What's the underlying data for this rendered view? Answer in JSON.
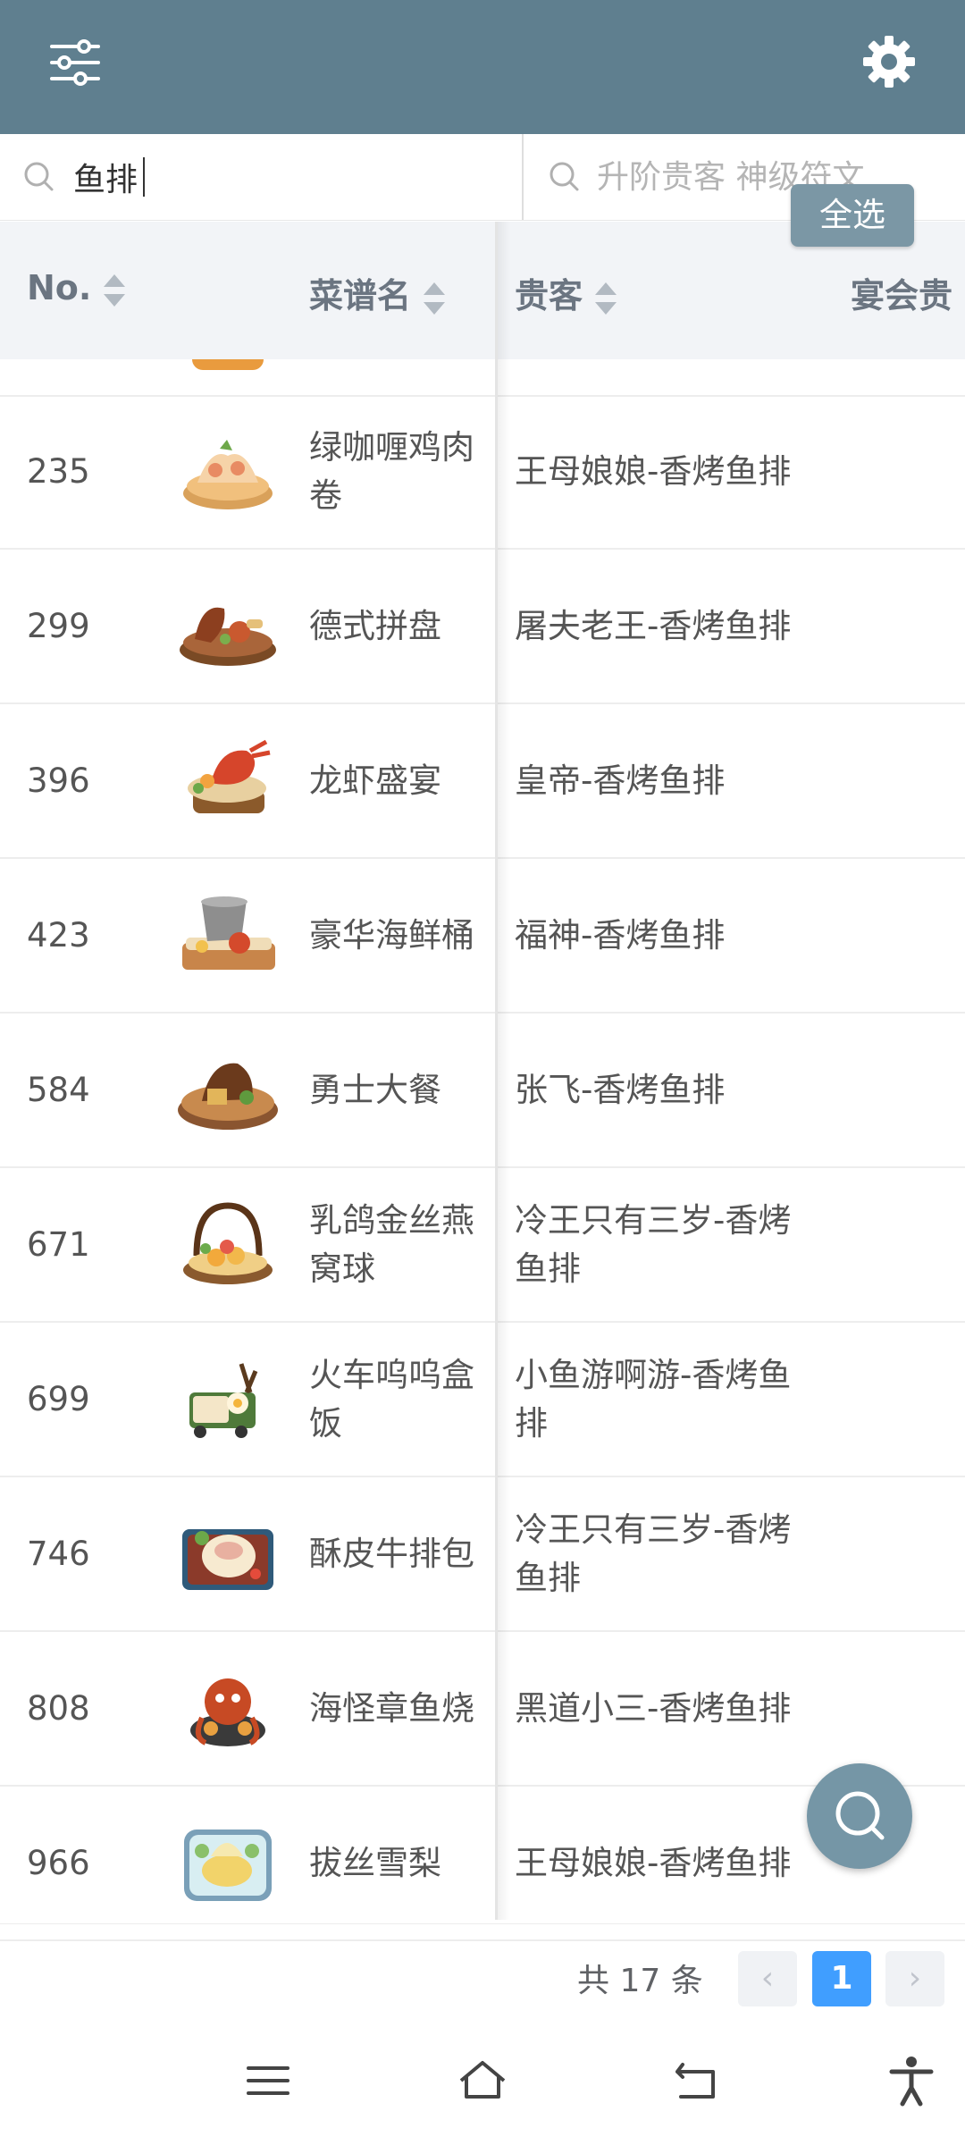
{
  "search": {
    "dish_value": "鱼排",
    "guest_placeholder": "升阶贵客 神级符文"
  },
  "select_all_label": "全选",
  "table": {
    "columns": [
      {
        "label": "No."
      },
      {
        "label": "菜谱名"
      },
      {
        "label": "贵客"
      },
      {
        "label": "宴会贵"
      }
    ],
    "rows": [
      {
        "no": "235",
        "name": "绿咖喱鸡肉卷",
        "guest": "王母娘娘-香烤鱼排",
        "dish_icon": "green-curry-chicken-roll-dish-icon"
      },
      {
        "no": "299",
        "name": "德式拼盘",
        "guest": "屠夫老王-香烤鱼排",
        "dish_icon": "german-platter-dish-icon"
      },
      {
        "no": "396",
        "name": "龙虾盛宴",
        "guest": "皇帝-香烤鱼排",
        "dish_icon": "lobster-feast-dish-icon"
      },
      {
        "no": "423",
        "name": "豪华海鲜桶",
        "guest": "福神-香烤鱼排",
        "dish_icon": "seafood-bucket-dish-icon"
      },
      {
        "no": "584",
        "name": "勇士大餐",
        "guest": "张飞-香烤鱼排",
        "dish_icon": "warrior-meal-dish-icon"
      },
      {
        "no": "671",
        "name": "乳鸽金丝燕窝球",
        "guest": "冷王只有三岁-香烤鱼排",
        "dish_icon": "pigeon-nest-ball-dish-icon"
      },
      {
        "no": "699",
        "name": "火车呜呜盒饭",
        "guest": "小鱼游啊游-香烤鱼排",
        "dish_icon": "train-bento-dish-icon"
      },
      {
        "no": "746",
        "name": "酥皮牛排包",
        "guest": "冷王只有三岁-香烤鱼排",
        "dish_icon": "steak-pastry-dish-icon"
      },
      {
        "no": "808",
        "name": "海怪章鱼烧",
        "guest": "黑道小三-香烤鱼排",
        "dish_icon": "octopus-ball-dish-icon"
      },
      {
        "no": "966",
        "name": "拔丝雪梨",
        "guest": "王母娘娘-香烤鱼排",
        "dish_icon": "candied-pear-dish-icon"
      }
    ]
  },
  "pagination": {
    "total_text": "共 17 条",
    "current_page": "1",
    "prev_symbol": "‹",
    "next_symbol": "›"
  },
  "colors": {
    "header_bg": "#5f7f8f",
    "accent": "#409eff",
    "fab_bg": "#7596a6"
  }
}
